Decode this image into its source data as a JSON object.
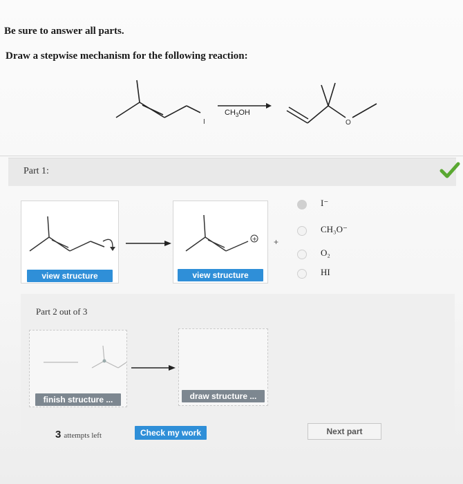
{
  "instructions": {
    "line1": "Be sure to answer all parts.",
    "line2": "Draw a stepwise mechanism for the following reaction:"
  },
  "reaction": {
    "reagent": "CH3OH",
    "leaving_group_label": "I"
  },
  "part1": {
    "label": "Part 1:",
    "status_icon": "check-icon",
    "status_color": "#5aa832",
    "left_button": "view structure",
    "middle_button": "view structure",
    "plus": "+",
    "charge": "⊕",
    "options": [
      "I⁻",
      "CH₃O⁻",
      "O₂",
      "HI"
    ]
  },
  "part2": {
    "label": "Part 2 out of 3",
    "left_button": "finish structure ...",
    "right_button": "draw structure ..."
  },
  "footer": {
    "attempts_count": "3",
    "attempts_text": "attempts left",
    "check_button": "Check my work",
    "next_button": "Next part"
  }
}
